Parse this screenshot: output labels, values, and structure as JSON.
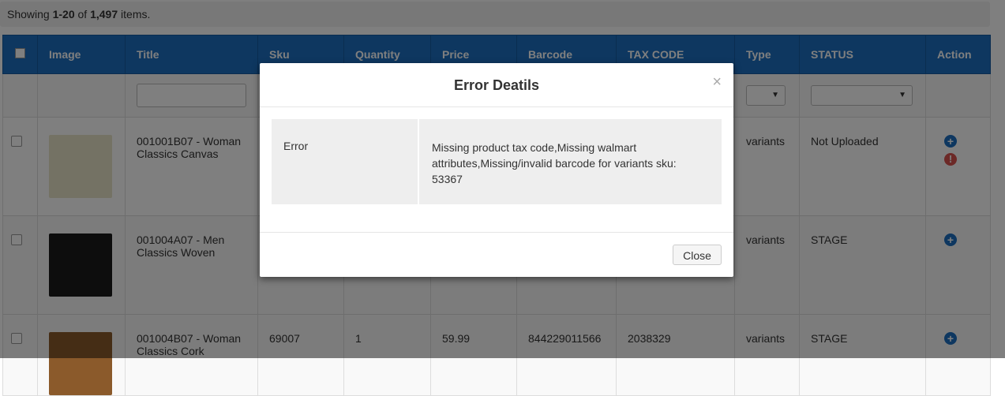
{
  "summary": {
    "prefix": "Showing ",
    "range": "1-20",
    "of": " of ",
    "total": "1,497",
    "suffix": " items."
  },
  "columns": [
    "Image",
    "Title",
    "Sku",
    "Quantity",
    "Price",
    "Barcode",
    "TAX CODE",
    "Type",
    "STATUS",
    "Action"
  ],
  "rows": [
    {
      "title": "001001B07 - Woman Classics Canvas",
      "sku": "",
      "quantity": "",
      "price": "",
      "barcode": "",
      "tax_code": "",
      "type": "variants",
      "status": "Not Uploaded",
      "image_color": "#e8e4c8"
    },
    {
      "title": "001004A07 - Men Classics Woven",
      "sku": "",
      "quantity": "",
      "price": "",
      "barcode": "",
      "tax_code": "",
      "type": "variants",
      "status": "STAGE",
      "image_color": "#1a1a1a"
    },
    {
      "title": "001004B07 - Woman Classics Cork",
      "sku": "69007",
      "quantity": "1",
      "price": "59.99",
      "barcode": "844229011566",
      "tax_code": "2038329",
      "type": "variants",
      "status": "STAGE",
      "image_color": "#8b5a2b"
    }
  ],
  "modal": {
    "title": "Error Deatils",
    "close_x": "×",
    "error_label": "Error",
    "error_message": "Missing product tax code,Missing walmart attributes,Missing/invalid barcode for variants sku: 53367",
    "close_button": "Close"
  },
  "icons": {
    "add": "plus-circle-icon",
    "error": "exclamation-circle-icon"
  },
  "colors": {
    "header": "#1c6fc1",
    "add_icon": "#1c6fc1",
    "error_icon": "#d9534f"
  }
}
